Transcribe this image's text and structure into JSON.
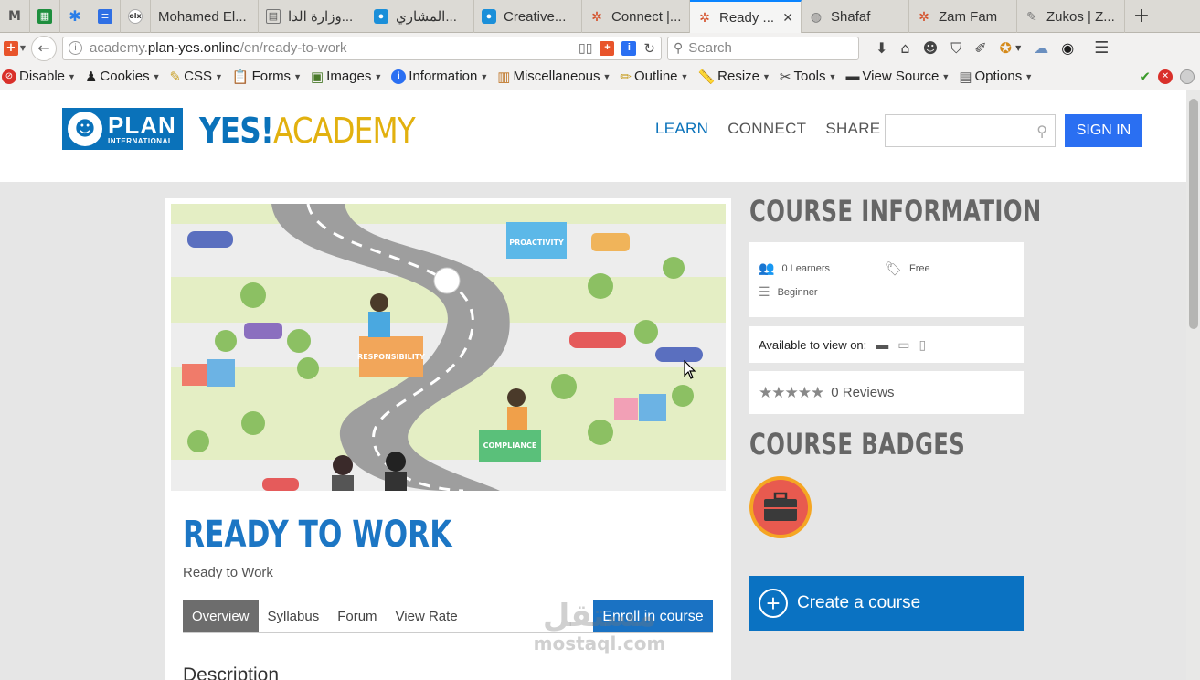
{
  "browser": {
    "tabs": [
      {
        "label": "Mohamed El..."
      },
      {
        "label": "وزارة الدا..."
      },
      {
        "label": "المشاري..."
      },
      {
        "label": "Creative..."
      },
      {
        "label": "Connect |..."
      },
      {
        "label": "Ready ...",
        "active": true
      },
      {
        "label": "Shafaf"
      },
      {
        "label": "Zam Fam"
      },
      {
        "label": "Zukos | Z..."
      }
    ],
    "url_prefix": "academy.",
    "url_domain": "plan-yes.online",
    "url_path": "/en/ready-to-work",
    "search_placeholder": "Search"
  },
  "devtoolbar": {
    "items": [
      "Disable",
      "Cookies",
      "CSS",
      "Forms",
      "Images",
      "Information",
      "Miscellaneous",
      "Outline",
      "Resize",
      "Tools",
      "View Source",
      "Options"
    ]
  },
  "site": {
    "logo_plan": "PLAN",
    "logo_international": "INTERNATIONAL",
    "logo_yes": "YES!",
    "logo_academy": "ACADEMY",
    "nav": {
      "learn": "LEARN",
      "connect": "CONNECT",
      "share": "SHARE"
    },
    "signin": "SIGN IN"
  },
  "hero": {
    "labels": {
      "proactivity": "PROACTIVITY",
      "responsibility": "RESPONSIBILITY",
      "compliance": "COMPLIANCE"
    }
  },
  "course": {
    "title": "READY TO WORK",
    "subtitle": "Ready to Work",
    "tabs": [
      "Overview",
      "Syllabus",
      "Forum",
      "View Rate"
    ],
    "enroll": "Enroll in course",
    "description_heading": "Description"
  },
  "sidebar": {
    "info_heading": "COURSE INFORMATION",
    "learners": "0 Learners",
    "price": "Free",
    "level": "Beginner",
    "available_label": "Available to view on:",
    "rating": 0,
    "reviews": "0 Reviews",
    "badges_heading": "COURSE BADGES",
    "create_course": "Create a course"
  },
  "watermark": {
    "arabic": "مستقل",
    "latin": "mostaql.com"
  },
  "colors": {
    "brand_blue": "#0a72ba",
    "brand_yellow": "#e2b10f",
    "signin_blue": "#2a6ff2",
    "tab_active_blue": "#0a84ff",
    "badge_red": "#e85a4f",
    "badge_orange": "#f5a623"
  }
}
